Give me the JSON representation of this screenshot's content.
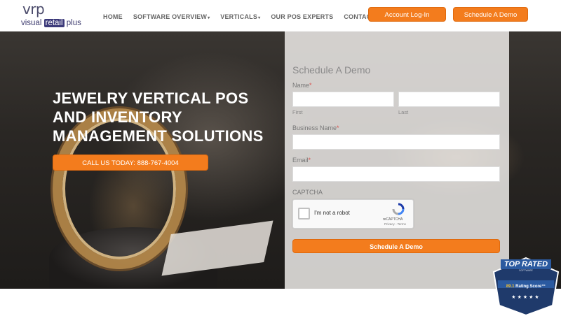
{
  "logo": {
    "top": "vrp",
    "visual": "visual",
    "retail": "retail",
    "plus": "plus"
  },
  "nav": {
    "items": [
      {
        "label": "HOME",
        "caret": ""
      },
      {
        "label": "SOFTWARE OVERVIEW",
        "caret": "▾"
      },
      {
        "label": "VERTICALS",
        "caret": "▾"
      },
      {
        "label": "OUR POS EXPERTS",
        "caret": ""
      },
      {
        "label": "CONTACT",
        "caret": ""
      }
    ]
  },
  "header_buttons": {
    "login": "Account Log-In",
    "demo": "Schedule A Demo"
  },
  "hero": {
    "title": "JEWELRY VERTICAL POS AND INVENTORY MANAGEMENT SOLUTIONS",
    "cta": "CALL US TODAY: 888-767-4004"
  },
  "form": {
    "title": "Schedule A Demo",
    "name_label": "Name",
    "first_label": "First",
    "last_label": "Last",
    "business_label": "Business Name",
    "email_label": "Email",
    "required_mark": "*",
    "captcha_label": "CAPTCHA",
    "captcha_text": "I'm not a robot",
    "captcha_brand": "reCAPTCHA",
    "captcha_links": "Privacy - Terms",
    "submit": "Schedule A Demo"
  },
  "badge": {
    "title": "TOP RATED",
    "sub": "SOFTWARE",
    "score": "89.1",
    "score_label": "Rating Score™",
    "stars": "★★★★★"
  },
  "colors": {
    "accent": "#f37c1d",
    "brand": "#3c3a7a",
    "badge": "#1f3a6b"
  }
}
